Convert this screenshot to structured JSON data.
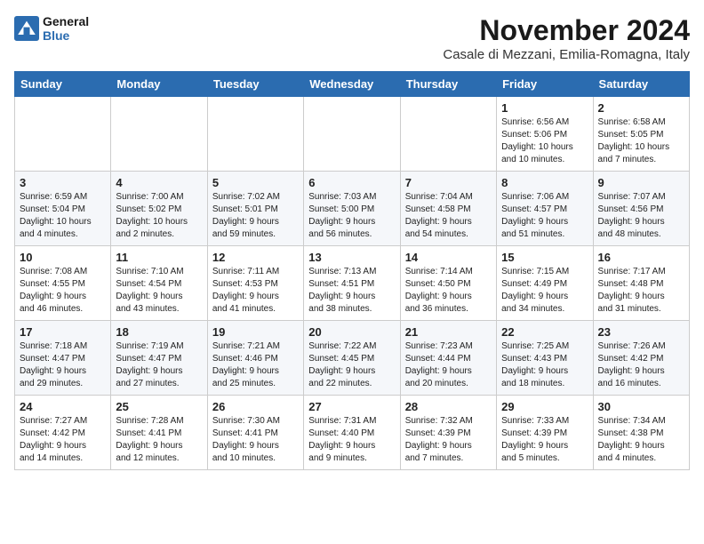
{
  "header": {
    "logo_line1": "General",
    "logo_line2": "Blue",
    "month": "November 2024",
    "location": "Casale di Mezzani, Emilia-Romagna, Italy"
  },
  "weekdays": [
    "Sunday",
    "Monday",
    "Tuesday",
    "Wednesday",
    "Thursday",
    "Friday",
    "Saturday"
  ],
  "weeks": [
    [
      {
        "day": "",
        "info": ""
      },
      {
        "day": "",
        "info": ""
      },
      {
        "day": "",
        "info": ""
      },
      {
        "day": "",
        "info": ""
      },
      {
        "day": "",
        "info": ""
      },
      {
        "day": "1",
        "info": "Sunrise: 6:56 AM\nSunset: 5:06 PM\nDaylight: 10 hours\nand 10 minutes."
      },
      {
        "day": "2",
        "info": "Sunrise: 6:58 AM\nSunset: 5:05 PM\nDaylight: 10 hours\nand 7 minutes."
      }
    ],
    [
      {
        "day": "3",
        "info": "Sunrise: 6:59 AM\nSunset: 5:04 PM\nDaylight: 10 hours\nand 4 minutes."
      },
      {
        "day": "4",
        "info": "Sunrise: 7:00 AM\nSunset: 5:02 PM\nDaylight: 10 hours\nand 2 minutes."
      },
      {
        "day": "5",
        "info": "Sunrise: 7:02 AM\nSunset: 5:01 PM\nDaylight: 9 hours\nand 59 minutes."
      },
      {
        "day": "6",
        "info": "Sunrise: 7:03 AM\nSunset: 5:00 PM\nDaylight: 9 hours\nand 56 minutes."
      },
      {
        "day": "7",
        "info": "Sunrise: 7:04 AM\nSunset: 4:58 PM\nDaylight: 9 hours\nand 54 minutes."
      },
      {
        "day": "8",
        "info": "Sunrise: 7:06 AM\nSunset: 4:57 PM\nDaylight: 9 hours\nand 51 minutes."
      },
      {
        "day": "9",
        "info": "Sunrise: 7:07 AM\nSunset: 4:56 PM\nDaylight: 9 hours\nand 48 minutes."
      }
    ],
    [
      {
        "day": "10",
        "info": "Sunrise: 7:08 AM\nSunset: 4:55 PM\nDaylight: 9 hours\nand 46 minutes."
      },
      {
        "day": "11",
        "info": "Sunrise: 7:10 AM\nSunset: 4:54 PM\nDaylight: 9 hours\nand 43 minutes."
      },
      {
        "day": "12",
        "info": "Sunrise: 7:11 AM\nSunset: 4:53 PM\nDaylight: 9 hours\nand 41 minutes."
      },
      {
        "day": "13",
        "info": "Sunrise: 7:13 AM\nSunset: 4:51 PM\nDaylight: 9 hours\nand 38 minutes."
      },
      {
        "day": "14",
        "info": "Sunrise: 7:14 AM\nSunset: 4:50 PM\nDaylight: 9 hours\nand 36 minutes."
      },
      {
        "day": "15",
        "info": "Sunrise: 7:15 AM\nSunset: 4:49 PM\nDaylight: 9 hours\nand 34 minutes."
      },
      {
        "day": "16",
        "info": "Sunrise: 7:17 AM\nSunset: 4:48 PM\nDaylight: 9 hours\nand 31 minutes."
      }
    ],
    [
      {
        "day": "17",
        "info": "Sunrise: 7:18 AM\nSunset: 4:47 PM\nDaylight: 9 hours\nand 29 minutes."
      },
      {
        "day": "18",
        "info": "Sunrise: 7:19 AM\nSunset: 4:47 PM\nDaylight: 9 hours\nand 27 minutes."
      },
      {
        "day": "19",
        "info": "Sunrise: 7:21 AM\nSunset: 4:46 PM\nDaylight: 9 hours\nand 25 minutes."
      },
      {
        "day": "20",
        "info": "Sunrise: 7:22 AM\nSunset: 4:45 PM\nDaylight: 9 hours\nand 22 minutes."
      },
      {
        "day": "21",
        "info": "Sunrise: 7:23 AM\nSunset: 4:44 PM\nDaylight: 9 hours\nand 20 minutes."
      },
      {
        "day": "22",
        "info": "Sunrise: 7:25 AM\nSunset: 4:43 PM\nDaylight: 9 hours\nand 18 minutes."
      },
      {
        "day": "23",
        "info": "Sunrise: 7:26 AM\nSunset: 4:42 PM\nDaylight: 9 hours\nand 16 minutes."
      }
    ],
    [
      {
        "day": "24",
        "info": "Sunrise: 7:27 AM\nSunset: 4:42 PM\nDaylight: 9 hours\nand 14 minutes."
      },
      {
        "day": "25",
        "info": "Sunrise: 7:28 AM\nSunset: 4:41 PM\nDaylight: 9 hours\nand 12 minutes."
      },
      {
        "day": "26",
        "info": "Sunrise: 7:30 AM\nSunset: 4:41 PM\nDaylight: 9 hours\nand 10 minutes."
      },
      {
        "day": "27",
        "info": "Sunrise: 7:31 AM\nSunset: 4:40 PM\nDaylight: 9 hours\nand 9 minutes."
      },
      {
        "day": "28",
        "info": "Sunrise: 7:32 AM\nSunset: 4:39 PM\nDaylight: 9 hours\nand 7 minutes."
      },
      {
        "day": "29",
        "info": "Sunrise: 7:33 AM\nSunset: 4:39 PM\nDaylight: 9 hours\nand 5 minutes."
      },
      {
        "day": "30",
        "info": "Sunrise: 7:34 AM\nSunset: 4:38 PM\nDaylight: 9 hours\nand 4 minutes."
      }
    ]
  ]
}
